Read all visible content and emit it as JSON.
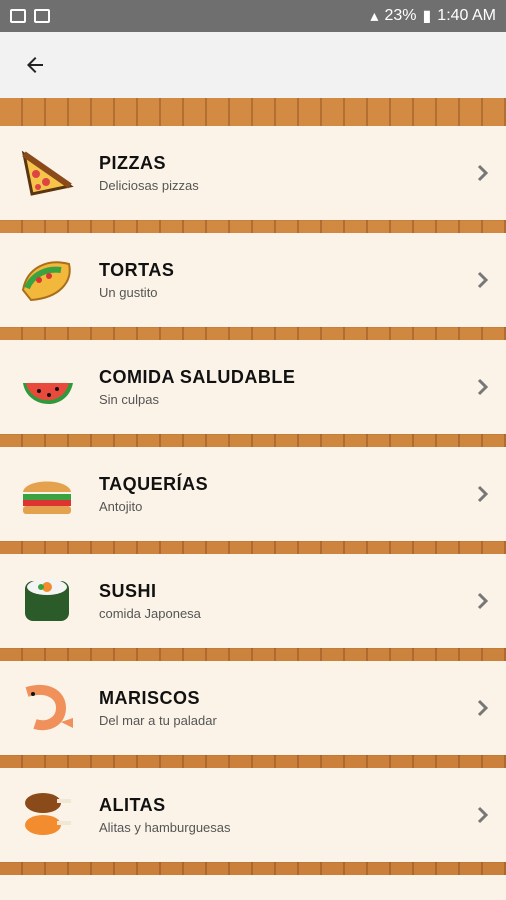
{
  "status": {
    "battery": "23%",
    "time": "1:40 AM"
  },
  "categories": [
    {
      "title": "PIZZAS",
      "subtitle": "Deliciosas pizzas",
      "icon": "pizza-icon"
    },
    {
      "title": "TORTAS",
      "subtitle": "Un gustito",
      "icon": "taco-icon"
    },
    {
      "title": "COMIDA SALUDABLE",
      "subtitle": "Sin culpas",
      "icon": "watermelon-icon"
    },
    {
      "title": "TAQUERÍAS",
      "subtitle": "Antojito",
      "icon": "burger-icon"
    },
    {
      "title": "SUSHI",
      "subtitle": "comida Japonesa",
      "icon": "sushi-icon"
    },
    {
      "title": "MARISCOS",
      "subtitle": "Del mar a tu paladar",
      "icon": "shrimp-icon"
    },
    {
      "title": "ALITAS",
      "subtitle": "Alitas y hamburguesas",
      "icon": "chicken-wings-icon"
    }
  ]
}
